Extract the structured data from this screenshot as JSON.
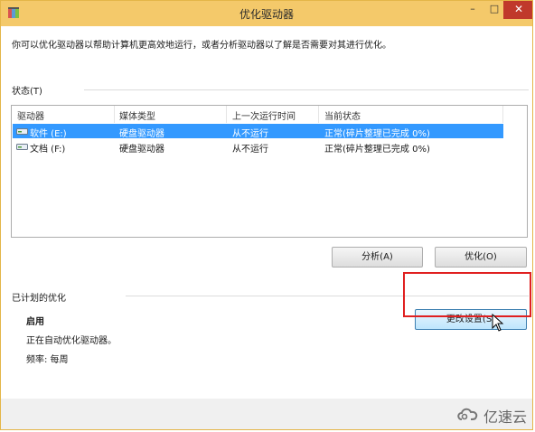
{
  "window": {
    "title": "优化驱动器",
    "min_label": "–",
    "max_label": "□",
    "close_label": "✕"
  },
  "description": "你可以优化驱动器以帮助计算机更高效地运行，或者分析驱动器以了解是否需要对其进行优化。",
  "status_section": {
    "label": "状态(T)"
  },
  "table": {
    "columns": [
      "驱动器",
      "媒体类型",
      "上一次运行时间",
      "当前状态"
    ],
    "rows": [
      {
        "drive": "软件 (E:)",
        "media": "硬盘驱动器",
        "last_run": "从不运行",
        "status": "正常(碎片整理已完成 0%)",
        "selected": true
      },
      {
        "drive": "文档 (F:)",
        "media": "硬盘驱动器",
        "last_run": "从不运行",
        "status": "正常(碎片整理已完成 0%)",
        "selected": false
      }
    ]
  },
  "buttons": {
    "analyze": "分析(A)",
    "optimize": "优化(O)",
    "change_settings": "更改设置(S)"
  },
  "scheduled": {
    "label": "已计划的优化",
    "state": "启用",
    "auto_text": "正在自动优化驱动器。",
    "frequency": "频率: 每周"
  },
  "watermark": {
    "text": "亿速云"
  },
  "colors": {
    "titlebar": "#f4c96a",
    "selection": "#3399ff",
    "highlight_box": "#e02020"
  }
}
